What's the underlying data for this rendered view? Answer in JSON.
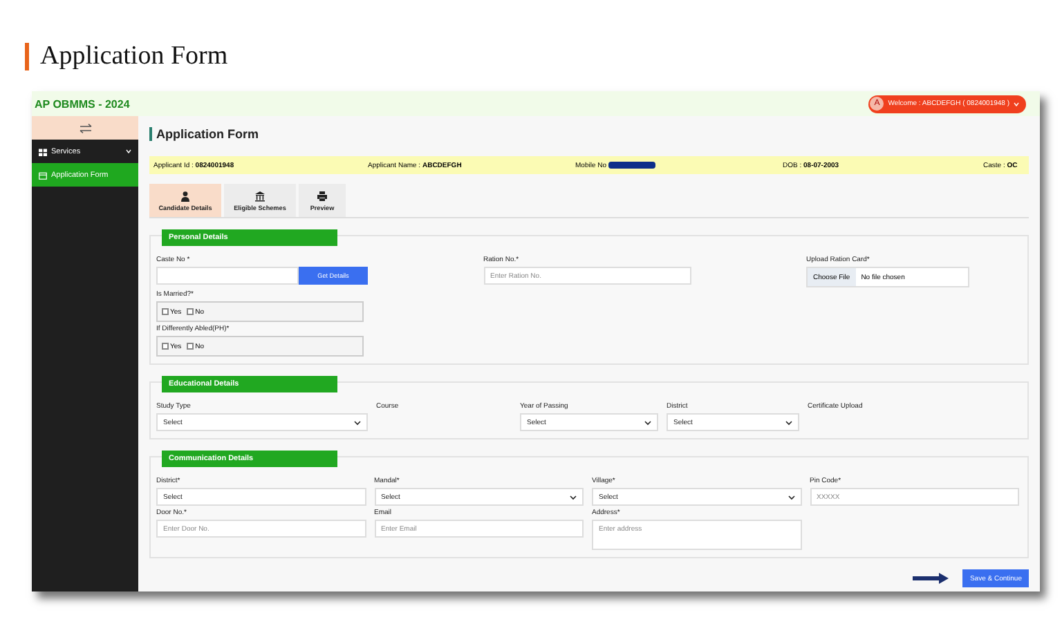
{
  "slide_title": "Application Form",
  "app": {
    "brand": "AP OBMMS - 2024",
    "user_menu": {
      "avatar": "A",
      "label": "Welcome : ABCDEFGH ( 0824001948 )"
    }
  },
  "sidebar": {
    "items": [
      {
        "label": "Services",
        "kind": "group",
        "selected": false
      },
      {
        "label": "Application Form",
        "kind": "page",
        "selected": true
      }
    ]
  },
  "page_title": "Application Form",
  "info_bar": [
    {
      "label": "Applicant Id :",
      "value": "0824001948",
      "redacted": false
    },
    {
      "label": "Applicant Name :",
      "value": "ABCDEFGH",
      "redacted": false
    },
    {
      "label": "Mobile No",
      "redacted": true
    },
    {
      "label": "DOB :",
      "value": "08-07-2003",
      "redacted": false
    },
    {
      "label": "Caste :",
      "value": "OC",
      "redacted": false
    }
  ],
  "tabs": [
    {
      "label": "Candidate Details",
      "kind": "user",
      "selected": true
    },
    {
      "label": "Eligible Schemes",
      "kind": "bank",
      "selected": false
    },
    {
      "label": "Preview",
      "kind": "print",
      "selected": false
    }
  ],
  "sections": [
    {
      "title": "Personal Details",
      "rows": [
        [
          {
            "kind": "lookup",
            "label": "Caste No *",
            "button": "Get Details"
          },
          {
            "kind": "input",
            "label": "Ration No.*",
            "placeholder": "Enter Ration No."
          },
          {
            "kind": "file",
            "label": "Upload Ration Card*",
            "button": "Choose File",
            "status": "No file chosen"
          }
        ],
        [
          {
            "kind": "checks",
            "label": "Is Married?*",
            "options": [
              {
                "label": "Yes",
                "checked": false
              },
              {
                "label": "No",
                "checked": false
              }
            ]
          }
        ],
        [
          {
            "kind": "checks",
            "label": "If Differently Abled(PH)*",
            "options": [
              {
                "label": "Yes",
                "checked": false
              },
              {
                "label": "No",
                "checked": false
              }
            ]
          }
        ]
      ]
    },
    {
      "title": "Educational Details",
      "rows": [
        [
          {
            "kind": "select",
            "label": "Study Type",
            "value": "Select"
          },
          {
            "kind": "label",
            "label": "Course"
          },
          {
            "kind": "select",
            "label": "Year of Passing",
            "value": "Select"
          },
          {
            "kind": "select",
            "label": "District",
            "value": "Select"
          },
          {
            "kind": "label",
            "label": "Certificate Upload"
          }
        ]
      ]
    },
    {
      "title": "Communication Details",
      "rows": [
        [
          {
            "kind": "input",
            "label": "District*",
            "value": "Select"
          },
          {
            "kind": "select",
            "label": "Mandal*",
            "value": "Select"
          },
          {
            "kind": "select",
            "label": "Village*",
            "value": "Select"
          },
          {
            "kind": "input",
            "label": "Pin Code*",
            "placeholder": "XXXXX"
          }
        ],
        [
          {
            "kind": "input",
            "label": "Door No.*",
            "placeholder": "Enter Door No."
          },
          {
            "kind": "input",
            "label": "Email",
            "placeholder": "Enter Email"
          },
          {
            "kind": "textarea",
            "label": "Address*",
            "placeholder": "Enter address"
          }
        ]
      ]
    }
  ],
  "save_button": "Save & Continue"
}
